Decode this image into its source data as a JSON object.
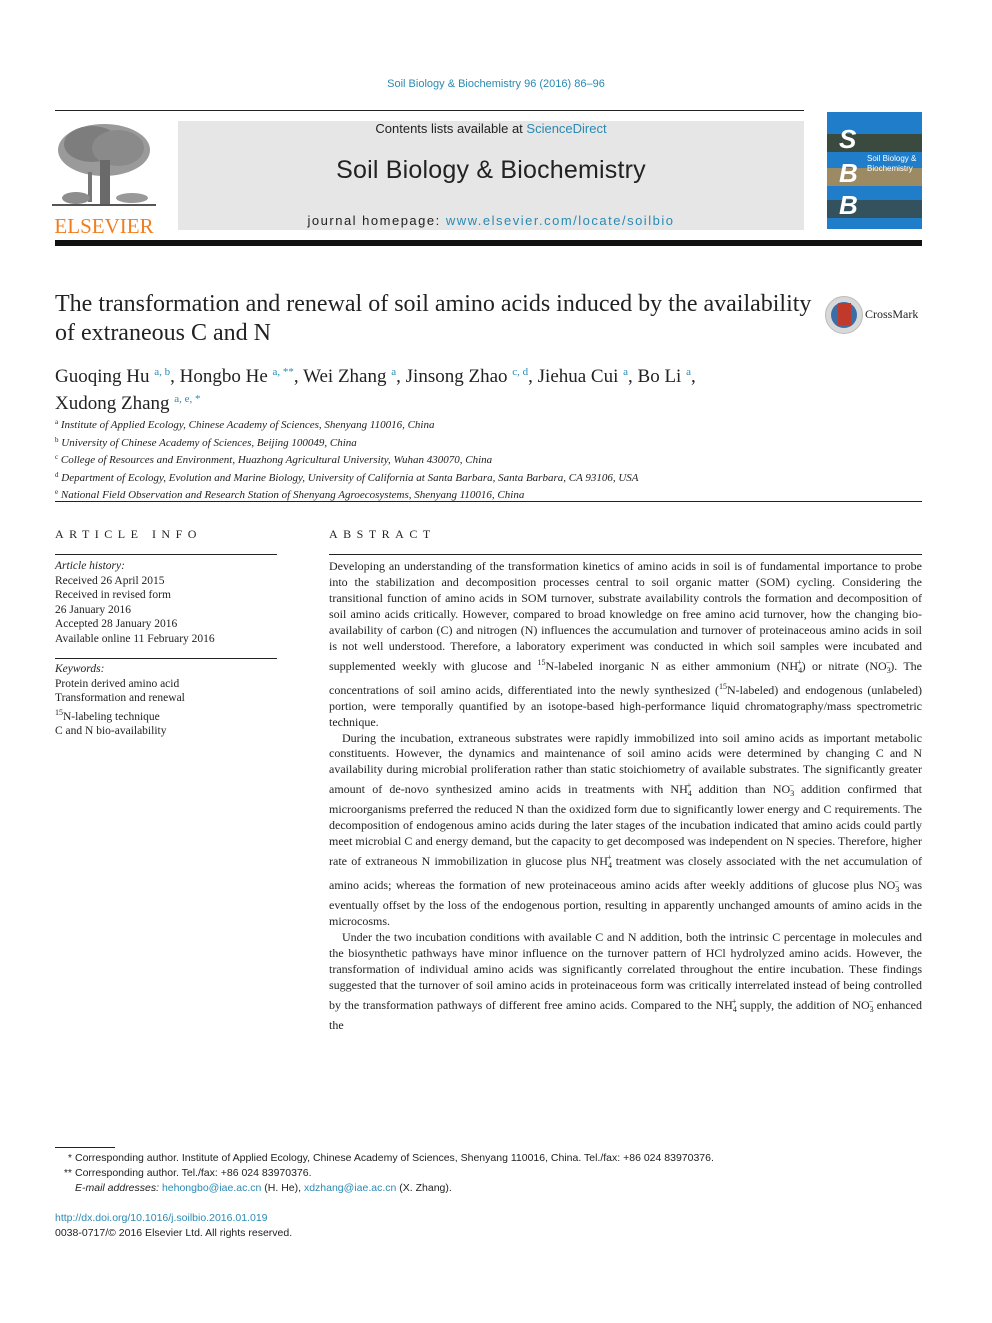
{
  "header": {
    "citation": "Soil Biology & Biochemistry 96 (2016) 86–96",
    "contents_prefix": "Contents lists available at ",
    "contents_link": "ScienceDirect",
    "journal_title": "Soil Biology & Biochemistry",
    "homepage_prefix": "journal homepage: ",
    "homepage_link": "www.elsevier.com/locate/soilbio",
    "publisher_logo": "ELSEVIER",
    "cover": {
      "letters": [
        "S",
        "B",
        "B"
      ],
      "title_line1": "Soil Biology &",
      "title_line2": "Biochemistry",
      "color": "#1f7dc9"
    }
  },
  "article": {
    "title": "The transformation and renewal of soil amino acids induced by the availability of extraneous C and N",
    "crossmark_label": "CrossMark",
    "authors": [
      {
        "name": "Guoqing Hu",
        "sup": "a, b",
        "sep": ", "
      },
      {
        "name": "Hongbo He",
        "sup": "a, **",
        "sep": ", "
      },
      {
        "name": "Wei Zhang",
        "sup": "a",
        "sep": ", "
      },
      {
        "name": "Jinsong Zhao",
        "sup": "c, d",
        "sep": ", "
      },
      {
        "name": "Jiehua Cui",
        "sup": "a",
        "sep": ", "
      },
      {
        "name": "Bo Li",
        "sup": "a",
        "sep": ","
      },
      {
        "name": "Xudong Zhang",
        "sup": "a, e, *",
        "sep": ""
      }
    ],
    "affiliations": [
      {
        "key": "a",
        "text": "Institute of Applied Ecology, Chinese Academy of Sciences, Shenyang 110016, China"
      },
      {
        "key": "b",
        "text": "University of Chinese Academy of Sciences, Beijing 100049, China"
      },
      {
        "key": "c",
        "text": "College of Resources and Environment, Huazhong Agricultural University, Wuhan 430070, China"
      },
      {
        "key": "d",
        "text": "Department of Ecology, Evolution and Marine Biology, University of California at Santa Barbara, Santa Barbara, CA 93106, USA"
      },
      {
        "key": "e",
        "text": "National Field Observation and Research Station of Shenyang Agroecosystems, Shenyang 110016, China"
      }
    ]
  },
  "article_info": {
    "heading": "ARTICLE INFO",
    "history_label": "Article history:",
    "history": [
      "Received 26 April 2015",
      "Received in revised form",
      "26 January 2016",
      "Accepted 28 January 2016",
      "Available online 11 February 2016"
    ],
    "keywords_label": "Keywords:",
    "keywords": [
      "Protein derived amino acid",
      "Transformation and renewal",
      "15N-labeling technique",
      "C and N bio-availability"
    ]
  },
  "abstract": {
    "heading": "ABSTRACT",
    "p1": {
      "a": "Developing an understanding of the transformation kinetics of amino acids in soil is of fundamental importance to probe into the stabilization and decomposition processes central to soil organic matter (SOM) cycling. Considering the transitional function of amino acids in SOM turnover, substrate availability controls the formation and decomposition of soil amino acids critically. However, compared to broad knowledge on free amino acid turnover, how the changing bio-availability of carbon (C) and nitrogen (N) influences the accumulation and turnover of proteinaceous amino acids in soil is not well understood. Therefore, a laboratory experiment was conducted in which soil samples were incubated and supplemented weekly with glucose and ",
      "b": "N-labeled inorganic N as either ammonium (",
      "c": ") or nitrate (",
      "d": "). The concentrations of soil amino acids, differentiated into the newly synthesized (",
      "e": "N-labeled) and endogenous (unlabeled) portion, were temporally quantified by an isotope-based high-performance liquid chromatography/mass spectrometric technique."
    },
    "p2": {
      "a": "During the incubation, extraneous substrates were rapidly immobilized into soil amino acids as important metabolic constituents. However, the dynamics and maintenance of soil amino acids were determined by changing C and N availability during microbial proliferation rather than static stoichiometry of available substrates. The significantly greater amount of de-novo synthesized amino acids in treatments with ",
      "b": " addition than ",
      "c": " addition confirmed that microorganisms preferred the reduced N than the oxidized form due to significantly lower energy and C requirements. The decomposition of endogenous amino acids during the later stages of the incubation indicated that amino acids could partly meet microbial C and energy demand, but the capacity to get decomposed was independent on N species. Therefore, higher rate of extraneous N immobilization in glucose plus ",
      "d": " treatment was closely associated with the net accumulation of amino acids; whereas the formation of new proteinaceous amino acids after weekly additions of glucose plus ",
      "e": " was eventually offset by the loss of the endogenous portion, resulting in apparently unchanged amounts of amino acids in the microcosms."
    },
    "p3": {
      "a": "Under the two incubation conditions with available C and N addition, both the intrinsic C percentage in molecules and the biosynthetic pathways have minor influence on the turnover pattern of HCl hydrolyzed amino acids. However, the transformation of individual amino acids was significantly correlated throughout the entire incubation. These findings suggested that the turnover of soil amino acids in proteinaceous form was critically interrelated instead of being controlled by the transformation pathways of different free amino acids. Compared to the ",
      "b": " supply, the addition of ",
      "c": " enhanced the"
    },
    "chem": {
      "ammonium": {
        "base": "NH",
        "sub": "4",
        "sup": "+"
      },
      "nitrate": {
        "base": "NO",
        "sub": "3",
        "sup": "−"
      },
      "isotope": "15"
    }
  },
  "footnotes": {
    "fn1_mark": "*",
    "fn1": "Corresponding author. Institute of Applied Ecology, Chinese Academy of Sciences, Shenyang 110016, China. Tel./fax: +86 024 83970376.",
    "fn2_mark": "**",
    "fn2": "Corresponding author. Tel./fax: +86 024 83970376.",
    "email_label": "E-mail addresses:",
    "email1": "hehongbo@iae.ac.cn",
    "email1_who": " (H. He), ",
    "email2": "xdzhang@iae.ac.cn",
    "email2_who": " (X. Zhang).",
    "doi": "http://dx.doi.org/10.1016/j.soilbio.2016.01.019",
    "copyright": "0038-0717/© 2016 Elsevier Ltd. All rights reserved."
  }
}
